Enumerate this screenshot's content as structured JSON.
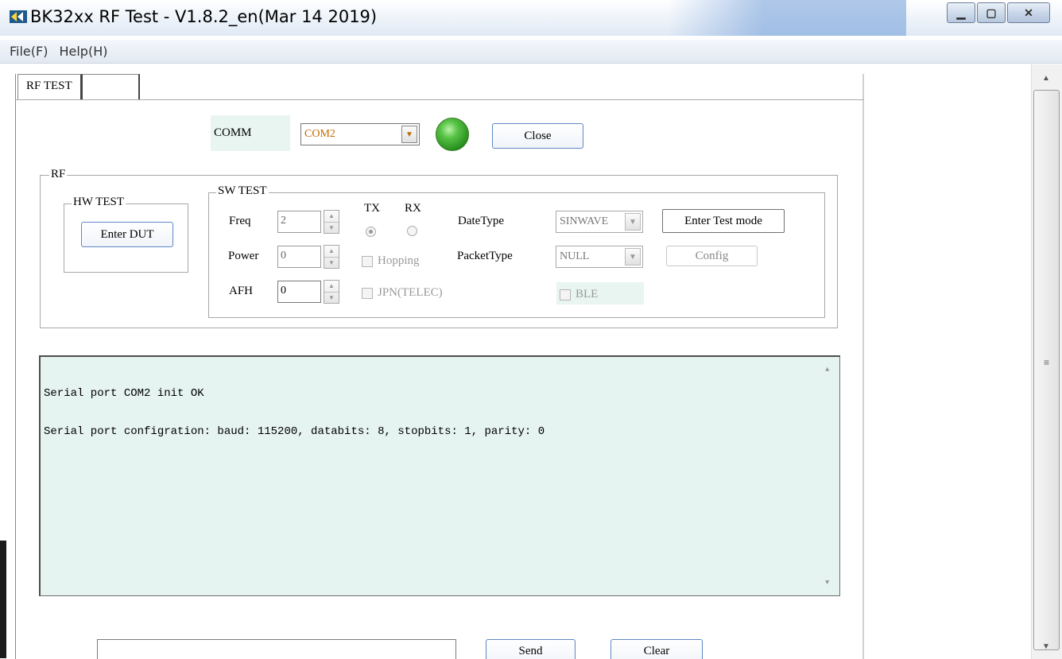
{
  "window": {
    "title": "BK32xx RF Test - V1.8.2_en(Mar 14 2019)",
    "icon": "app-logo-icon",
    "buttons": [
      "minimize",
      "maximize",
      "close"
    ]
  },
  "menu": {
    "items": [
      "File(F)",
      "Help(H)"
    ]
  },
  "tabs": [
    {
      "label": "RF TEST",
      "active": true
    },
    {
      "label": "",
      "active": false
    }
  ],
  "comm": {
    "label": "COMM",
    "port": "COM2",
    "status_color": "#3bb12c",
    "close_label": "Close"
  },
  "rf_group": {
    "title": "RF"
  },
  "hw_test": {
    "title": "HW TEST",
    "enter_dut_label": "Enter DUT"
  },
  "sw_test": {
    "title": "SW TEST",
    "freq_label": "Freq",
    "freq_value": "2",
    "power_label": "Power",
    "power_value": "0",
    "afh_label": "AFH",
    "afh_value": "0",
    "tx_label": "TX",
    "rx_label": "RX",
    "tx_selected": true,
    "hopping_label": "Hopping",
    "jpn_label": "JPN(TELEC)",
    "datetype_label": "DateType",
    "datetype_value": "SINWAVE",
    "packettype_label": "PacketType",
    "packettype_value": "NULL",
    "ble_label": "BLE",
    "enter_test_mode_label": "Enter Test mode",
    "config_label": "Config"
  },
  "log": {
    "lines": [
      "Serial port COM2 init OK",
      "Serial port configration: baud: 115200, databits: 8, stopbits: 1, parity: 0"
    ]
  },
  "send_bar": {
    "input_value": "",
    "send_label": "Send",
    "clear_label": "Clear"
  }
}
